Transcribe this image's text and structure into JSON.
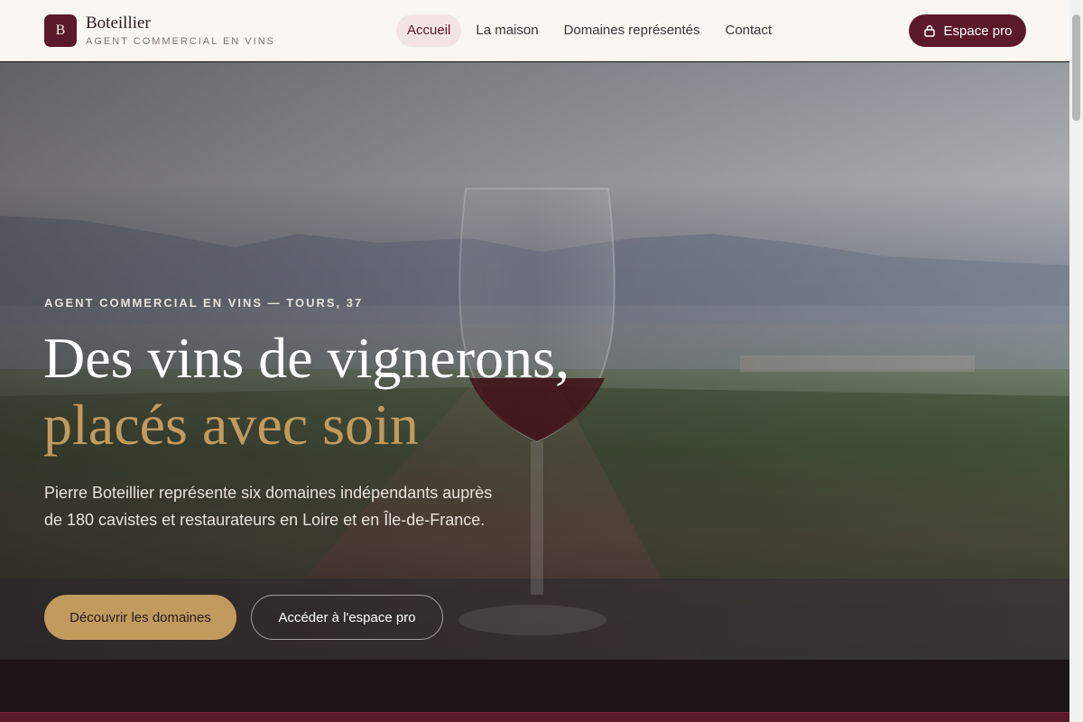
{
  "brand": {
    "logo_letter": "B",
    "name": "Boteillier",
    "tagline": "AGENT COMMERCIAL EN VINS"
  },
  "nav": {
    "items": [
      {
        "label": "Accueil",
        "active": true
      },
      {
        "label": "La maison",
        "active": false
      },
      {
        "label": "Domaines représentés",
        "active": false
      },
      {
        "label": "Contact",
        "active": false
      }
    ]
  },
  "header": {
    "pro_button": {
      "label": "Espace pro",
      "icon": "lock-icon"
    }
  },
  "hero": {
    "eyebrow": "AGENT COMMERCIAL EN VINS — TOURS, 37",
    "title_line1": "Des vins de vignerons,",
    "title_line2": "placés avec soin",
    "lead": "Pierre Boteillier représente six domaines indépendants auprès de 180 cavistes et restaurateurs en Loire et en Île-de-France.",
    "cta_primary": "Découvrir les domaines",
    "cta_secondary": "Accéder à l'espace pro"
  },
  "colors": {
    "brand": "#5a1a2a",
    "accent": "#c19a5e",
    "header_bg": "#faf7f2",
    "nav_active_bg": "#f3e4e4"
  }
}
